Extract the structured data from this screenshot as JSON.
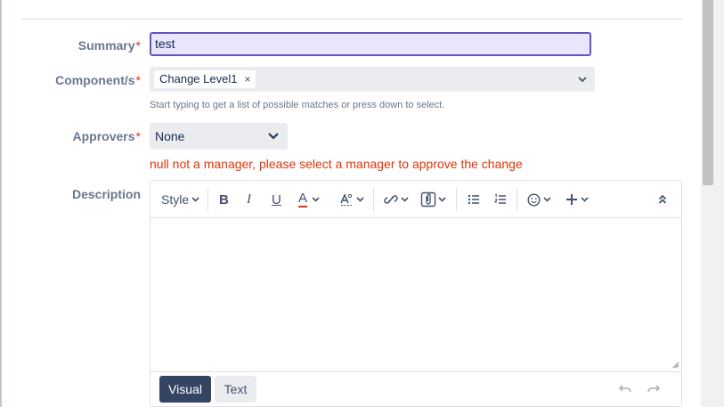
{
  "form": {
    "summary": {
      "label": "Summary",
      "required_mark": "*",
      "value": "test"
    },
    "components": {
      "label": "Component/s",
      "required_mark": "*",
      "chips": [
        {
          "label": "Change Level1",
          "remove": "×"
        }
      ],
      "helper": "Start typing to get a list of possible matches or press down to select."
    },
    "approvers": {
      "label": "Approvers",
      "required_mark": "*",
      "value": "None",
      "error": "null not a manager, please select a manager to approve the change"
    },
    "description": {
      "label": "Description",
      "toolbar": {
        "style_label": "Style"
      },
      "modes": {
        "visual": "Visual",
        "text": "Text"
      }
    }
  },
  "colors": {
    "required": "#de350b",
    "error": "#de350b",
    "focus_border": "#6554c0",
    "focus_bg": "#eae6ff",
    "visual_active": "#344563"
  }
}
